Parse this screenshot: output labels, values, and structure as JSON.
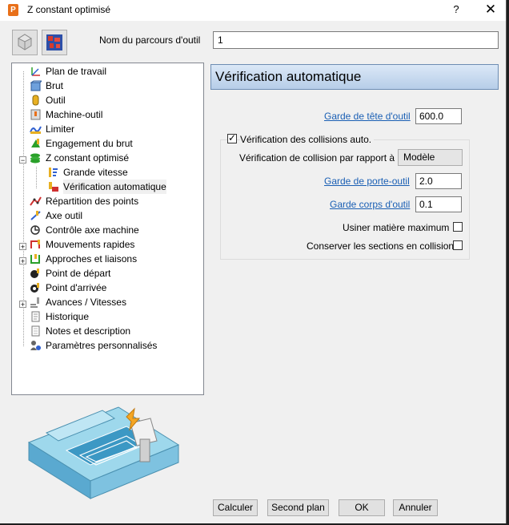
{
  "window": {
    "title": "Z constant optimisé",
    "help": "?",
    "close": "✕"
  },
  "toolpath": {
    "label": "Nom du parcours d'outil",
    "value": "1"
  },
  "tree": {
    "items": [
      {
        "label": "Plan de travail",
        "icon": "workplane-icon"
      },
      {
        "label": "Brut",
        "icon": "block-icon"
      },
      {
        "label": "Outil",
        "icon": "tool-icon"
      },
      {
        "label": "Machine-outil",
        "icon": "machine-tool-icon"
      },
      {
        "label": "Limiter",
        "icon": "limit-icon"
      },
      {
        "label": "Engagement du brut",
        "icon": "stock-engagement-icon"
      },
      {
        "label": "Z constant optimisé",
        "icon": "optimised-constant-z-icon"
      },
      {
        "label": "Grande vitesse",
        "icon": "high-speed-icon"
      },
      {
        "label": "Vérification automatique",
        "icon": "automatic-verification-icon"
      },
      {
        "label": "Répartition des points",
        "icon": "point-distribution-icon"
      },
      {
        "label": "Axe outil",
        "icon": "tool-axis-icon"
      },
      {
        "label": "Contrôle axe machine",
        "icon": "machine-axis-control-icon"
      },
      {
        "label": "Mouvements rapides",
        "icon": "rapid-moves-icon"
      },
      {
        "label": "Approches et liaisons",
        "icon": "leads-links-icon"
      },
      {
        "label": "Point de départ",
        "icon": "start-point-icon"
      },
      {
        "label": "Point d'arrivée",
        "icon": "end-point-icon"
      },
      {
        "label": "Avances / Vitesses",
        "icon": "feeds-speeds-icon"
      },
      {
        "label": "Historique",
        "icon": "history-icon"
      },
      {
        "label": "Notes et description",
        "icon": "notes-icon"
      },
      {
        "label": "Paramètres personnalisés",
        "icon": "user-parameters-icon"
      }
    ]
  },
  "panel": {
    "title": "Vérification automatique",
    "holder_clearance_tool_label": "Garde de tête d'outil",
    "holder_clearance_tool_value": "600.0",
    "collision_check_label": "Vérification des collisions auto.",
    "collision_check_checked": true,
    "check_against_label": "Vérification de collision par rapport à",
    "check_against_value": "Modèle",
    "holder_clearance_label": "Garde de porte-outil",
    "holder_clearance_value": "2.0",
    "shank_clearance_label": "Garde corps d'outil",
    "shank_clearance_value": "0.1",
    "max_material_label": "Usiner matière maximum",
    "max_material_checked": false,
    "keep_sections_label": "Conserver les sections en collision",
    "keep_sections_checked": false
  },
  "buttons": {
    "calculate": "Calculer",
    "background": "Second plan",
    "ok": "OK",
    "cancel": "Annuler"
  },
  "colors": {
    "accent_link": "#1a5fb4",
    "header_bg": "#c6d9ef",
    "app_icon": "#e8701a"
  }
}
